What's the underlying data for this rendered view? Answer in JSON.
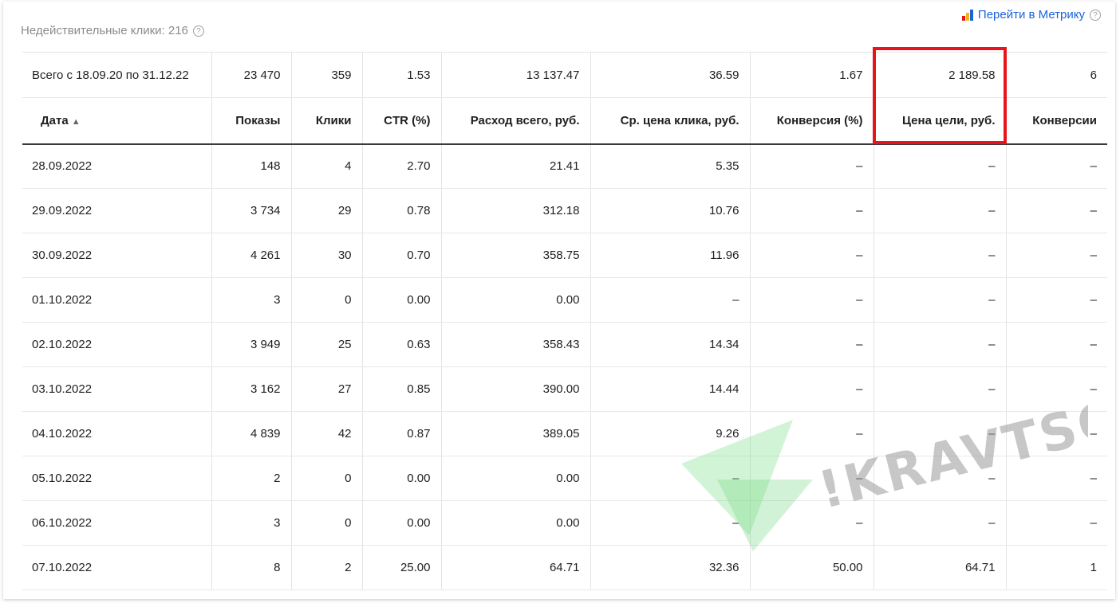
{
  "header": {
    "invalid_clicks": "Недействительные клики: 216",
    "help_icon": "?",
    "metrika_link": "Перейти в Метрику",
    "colors": {
      "link": "#1a63d8",
      "highlight": "#e8141c",
      "watermark": "#7fe08a"
    }
  },
  "totals": [
    "Всего с 18.09.20 по 31.12.22",
    "23 470",
    "359",
    "1.53",
    "13 137.47",
    "36.59",
    "1.67",
    "2 189.58",
    "6"
  ],
  "columns": [
    "Дата",
    "Показы",
    "Клики",
    "CTR (%)",
    "Расход всего, руб.",
    "Ср. цена клика, руб.",
    "Конверсия (%)",
    "Цена цели, руб.",
    "Конверсии"
  ],
  "sort_indicator": "▲",
  "rows": [
    [
      "28.09.2022",
      "148",
      "4",
      "2.70",
      "21.41",
      "5.35",
      "–",
      "–",
      "–"
    ],
    [
      "29.09.2022",
      "3 734",
      "29",
      "0.78",
      "312.18",
      "10.76",
      "–",
      "–",
      "–"
    ],
    [
      "30.09.2022",
      "4 261",
      "30",
      "0.70",
      "358.75",
      "11.96",
      "–",
      "–",
      "–"
    ],
    [
      "01.10.2022",
      "3",
      "0",
      "0.00",
      "0.00",
      "–",
      "–",
      "–",
      "–"
    ],
    [
      "02.10.2022",
      "3 949",
      "25",
      "0.63",
      "358.43",
      "14.34",
      "–",
      "–",
      "–"
    ],
    [
      "03.10.2022",
      "3 162",
      "27",
      "0.85",
      "390.00",
      "14.44",
      "–",
      "–",
      "–"
    ],
    [
      "04.10.2022",
      "4 839",
      "42",
      "0.87",
      "389.05",
      "9.26",
      "–",
      "–",
      "–"
    ],
    [
      "05.10.2022",
      "2",
      "0",
      "0.00",
      "0.00",
      "–",
      "–",
      "–",
      "–"
    ],
    [
      "06.10.2022",
      "3",
      "0",
      "0.00",
      "0.00",
      "–",
      "–",
      "–",
      "–"
    ],
    [
      "07.10.2022",
      "8",
      "2",
      "25.00",
      "64.71",
      "32.36",
      "50.00",
      "64.71",
      "1"
    ]
  ],
  "watermark_text": "!KRAVTSOV"
}
